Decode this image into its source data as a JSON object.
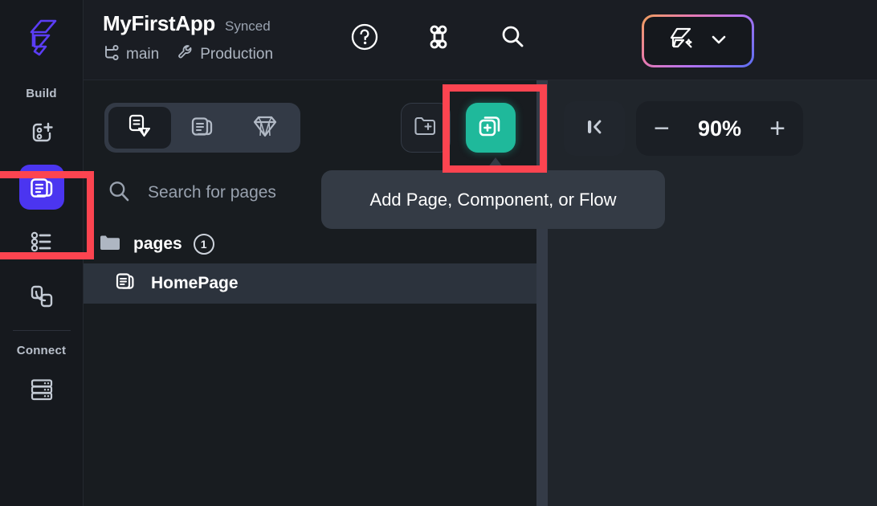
{
  "header": {
    "logo_icon": "flutterflow-logo-icon",
    "app_title": "MyFirstApp",
    "sync_status": "Synced",
    "branch_icon": "branch-icon",
    "branch_name": "main",
    "environment_icon": "wrench-icon",
    "environment_name": "Production",
    "icons": [
      {
        "name": "help-icon",
        "label": "Help"
      },
      {
        "name": "command-icon",
        "label": "Command Palette"
      },
      {
        "name": "search-icon",
        "label": "Search"
      }
    ],
    "ai_button": {
      "icon": "flutterflow-ai-magic-icon",
      "chevron_icon": "chevron-down-icon",
      "gradient_start": "#f0a05a",
      "gradient_end": "#5a6ef0"
    }
  },
  "sidebar": {
    "sections": [
      {
        "label": "Build",
        "items": [
          {
            "name": "sidebar-item-widget-palette",
            "icon": "add-widget-icon",
            "active": false
          },
          {
            "name": "sidebar-item-pages",
            "icon": "pages-icon",
            "active": true
          },
          {
            "name": "sidebar-item-components",
            "icon": "components-list-icon",
            "active": false
          },
          {
            "name": "sidebar-item-navigation",
            "icon": "navigation-flow-icon",
            "active": false
          }
        ]
      },
      {
        "label": "Connect",
        "items": [
          {
            "name": "sidebar-item-database",
            "icon": "database-icon",
            "active": false
          }
        ]
      }
    ]
  },
  "panel": {
    "segmented_tabs": [
      {
        "name": "tab-pages-and-components",
        "icon": "page-gem-icon",
        "active": true
      },
      {
        "name": "tab-components",
        "icon": "pages-stack-icon",
        "active": false
      },
      {
        "name": "tab-gems",
        "icon": "gem-icon",
        "active": false
      }
    ],
    "new_folder_button": {
      "name": "new-folder-button",
      "icon": "folder-plus-icon"
    },
    "add_button": {
      "name": "add-page-component-flow-button",
      "icon": "add-page-icon",
      "color": "#1fb99b"
    },
    "search": {
      "icon": "search-icon",
      "placeholder": "Search for pages",
      "value": ""
    },
    "tree": {
      "folder": {
        "icon": "folder-open-icon",
        "name": "pages",
        "count": "1"
      },
      "pages": [
        {
          "icon": "page-icon",
          "name": "HomePage",
          "selected": true
        }
      ]
    }
  },
  "tooltip": {
    "text": "Add Page, Component, or Flow"
  },
  "canvas_controls": {
    "collapse_button": {
      "name": "collapse-panel-button",
      "icon": "collapse-left-icon"
    },
    "zoom": {
      "decrease_label": "−",
      "value": "90%",
      "increase_label": "+"
    }
  },
  "annotations": {
    "color": "#fc4450",
    "boxes": [
      {
        "name": "annotation-add-button",
        "target": "add-page-component-flow-button"
      },
      {
        "name": "annotation-sidebar-pages",
        "target": "sidebar-item-pages"
      }
    ]
  }
}
